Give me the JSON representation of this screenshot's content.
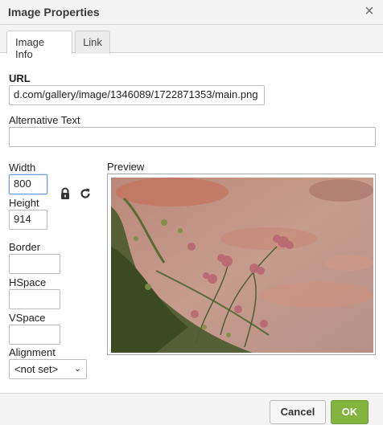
{
  "dialog": {
    "title": "Image Properties",
    "close_glyph": "×"
  },
  "tabs": [
    {
      "label": "Image Info",
      "active": true
    },
    {
      "label": "Link",
      "active": false
    }
  ],
  "fields": {
    "url_label": "URL",
    "url_value": "d.com/gallery/image/1346089/1722871353/main.png",
    "alt_label": "Alternative Text",
    "alt_value": "",
    "width_label": "Width",
    "width_value": "800",
    "height_label": "Height",
    "height_value": "914",
    "border_label": "Border",
    "border_value": "",
    "hspace_label": "HSpace",
    "hspace_value": "",
    "vspace_label": "VSpace",
    "vspace_value": "",
    "alignment_label": "Alignment",
    "alignment_value": "<not set>"
  },
  "preview": {
    "label": "Preview"
  },
  "icons": {
    "lock": "lock-icon",
    "reset": "reset-size-icon",
    "dropdown": "chevron-down-icon"
  },
  "buttons": {
    "cancel": "Cancel",
    "ok": "OK"
  },
  "colors": {
    "ok_button": "#83b440",
    "focus_border": "#6a9ad7"
  }
}
